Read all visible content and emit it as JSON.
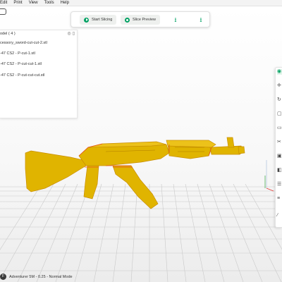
{
  "menu": [
    "Edit",
    "Print",
    "View",
    "Tools",
    "Help"
  ],
  "toolbar": {
    "start_slicing": "Start Slicing",
    "slice_preview": "Slice Preview"
  },
  "object_panel": {
    "header": "odel ( 4 )",
    "items": [
      "cessory_sword-cut-cut-2.stl",
      "-47 CS2 - P-cut-1.stl",
      "-47 CS2 - P-cut-cut-1.stl",
      "-47 CS2 - P-cut-cut-cut.stl"
    ]
  },
  "status_bar": {
    "printer": "Adventurer 5M - 0.25 - Normal Mode"
  },
  "colors": {
    "accent": "#00a163",
    "model": "#e0b400",
    "model_edge": "#e8501c"
  },
  "icons": {
    "home": "home-icon",
    "upload": "upload-icon",
    "print": "print-icon"
  }
}
